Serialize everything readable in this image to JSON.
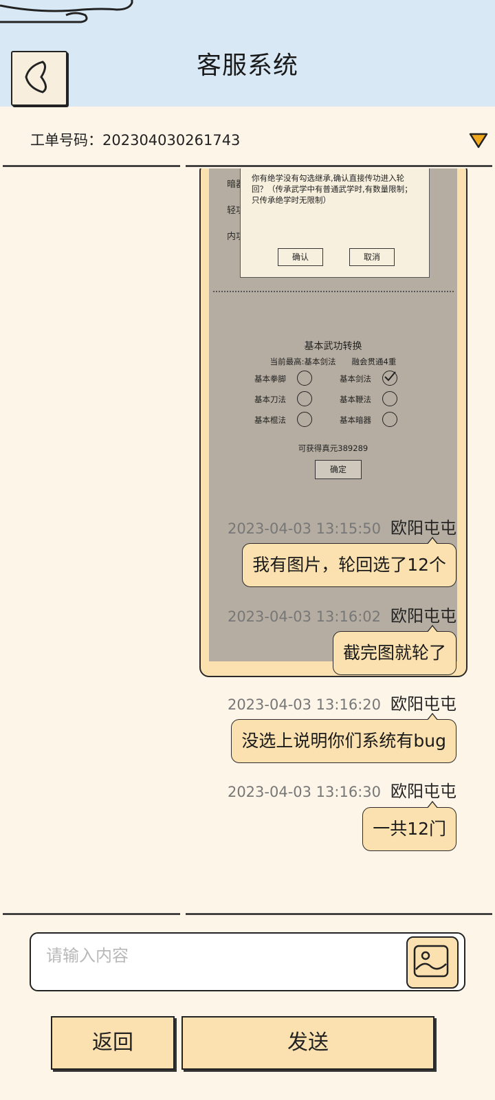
{
  "header": {
    "title": "客服系统"
  },
  "ticket": {
    "label": "工单号码：202304030261743"
  },
  "screenshot": {
    "side_labels": [
      "暗器",
      "轻功",
      "内功"
    ],
    "dialog": {
      "text": "你有绝学没有勾选继承,确认直接传功进入轮回？（传承武学中有普通武学时,有数量限制；只传承绝学时无限制）",
      "confirm": "确认",
      "cancel": "取消"
    },
    "conversion": {
      "title": "基本武功转换",
      "subtitle": "当前最高:基本剑法　　融会贯通4重",
      "options": [
        {
          "label": "基本拳脚",
          "checked": false
        },
        {
          "label": "基本剑法",
          "checked": true
        },
        {
          "label": "基本刀法",
          "checked": false
        },
        {
          "label": "基本鞭法",
          "checked": false
        },
        {
          "label": "基本棍法",
          "checked": false
        },
        {
          "label": "基本暗器",
          "checked": false
        }
      ],
      "gain": "可获得真元389289",
      "ok": "确定"
    }
  },
  "messages": [
    {
      "time": "2023-04-03 13:15:50",
      "name": "欧阳屯屯",
      "text": "我有图片，轮回选了12个"
    },
    {
      "time": "2023-04-03 13:16:02",
      "name": "欧阳屯屯",
      "text": "截完图就轮了"
    },
    {
      "time": "2023-04-03 13:16:20",
      "name": "欧阳屯屯",
      "text": "没选上说明你们系统有bug"
    },
    {
      "time": "2023-04-03 13:16:30",
      "name": "欧阳屯屯",
      "text": "一共12门"
    }
  ],
  "input": {
    "placeholder": "请输入内容",
    "value": ""
  },
  "buttons": {
    "back": "返回",
    "send": "发送"
  },
  "colors": {
    "header_bg": "#d8e9f5",
    "page_bg": "#fdf5e8",
    "bubble_bg": "#fbe1b0",
    "accent": "#f2a81d"
  },
  "icons": {
    "back": "chevron-left-icon",
    "dropdown": "triangle-down-icon",
    "image": "image-icon"
  }
}
